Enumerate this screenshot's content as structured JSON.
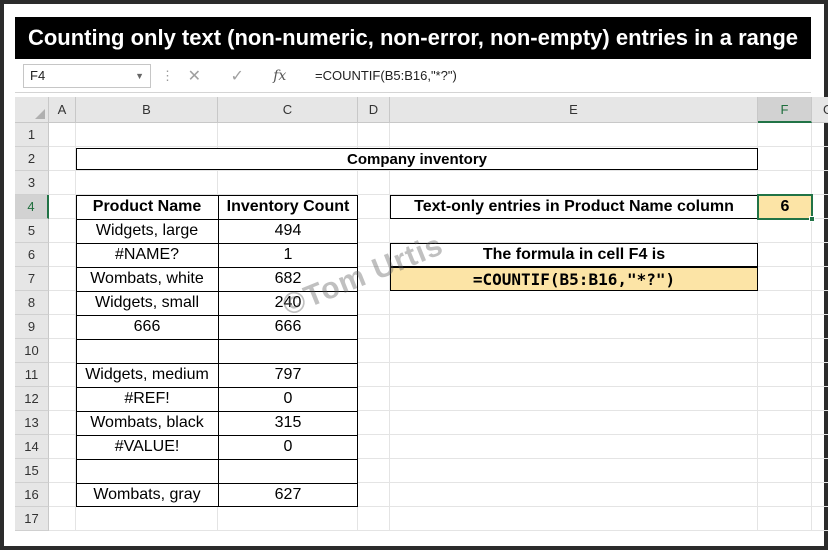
{
  "title": "Counting only text (non-numeric, non-error, non-empty) entries in a range",
  "formula_bar": {
    "name_box": "F4",
    "cancel_icon": "✕",
    "enter_icon": "✓",
    "fx_label": "fx",
    "formula": "=COUNTIF(B5:B16,\"*?\")"
  },
  "columns": [
    "A",
    "B",
    "C",
    "D",
    "E",
    "F",
    "G"
  ],
  "rows": [
    "1",
    "2",
    "3",
    "4",
    "5",
    "6",
    "7",
    "8",
    "9",
    "10",
    "11",
    "12",
    "13",
    "14",
    "15",
    "16",
    "17"
  ],
  "sheet": {
    "heading": "Company inventory",
    "table_headers": [
      "Product Name",
      "Inventory Count"
    ],
    "table_rows": [
      [
        "Widgets, large",
        "494"
      ],
      [
        "#NAME?",
        "1"
      ],
      [
        "Wombats, white",
        "682"
      ],
      [
        "Widgets, small",
        "240"
      ],
      [
        "666",
        "666"
      ],
      [
        "",
        ""
      ],
      [
        "Widgets, medium",
        "797"
      ],
      [
        "#REF!",
        "0"
      ],
      [
        "Wombats, black",
        "315"
      ],
      [
        "#VALUE!",
        "0"
      ],
      [
        "",
        ""
      ],
      [
        "Wombats, gray",
        "627"
      ]
    ],
    "result_label": "Text-only entries in Product Name column",
    "result_value": "6",
    "formula_caption": "The formula in cell F4 is",
    "formula_display": "=COUNTIF(B5:B16,\"*?\")"
  },
  "watermark": "©Tom Urtis",
  "colors": {
    "title_bg": "#000000",
    "formula_cell_bg": "#fce4a6",
    "result_cell_bg": "#fce4a6",
    "selection": "#217346"
  }
}
